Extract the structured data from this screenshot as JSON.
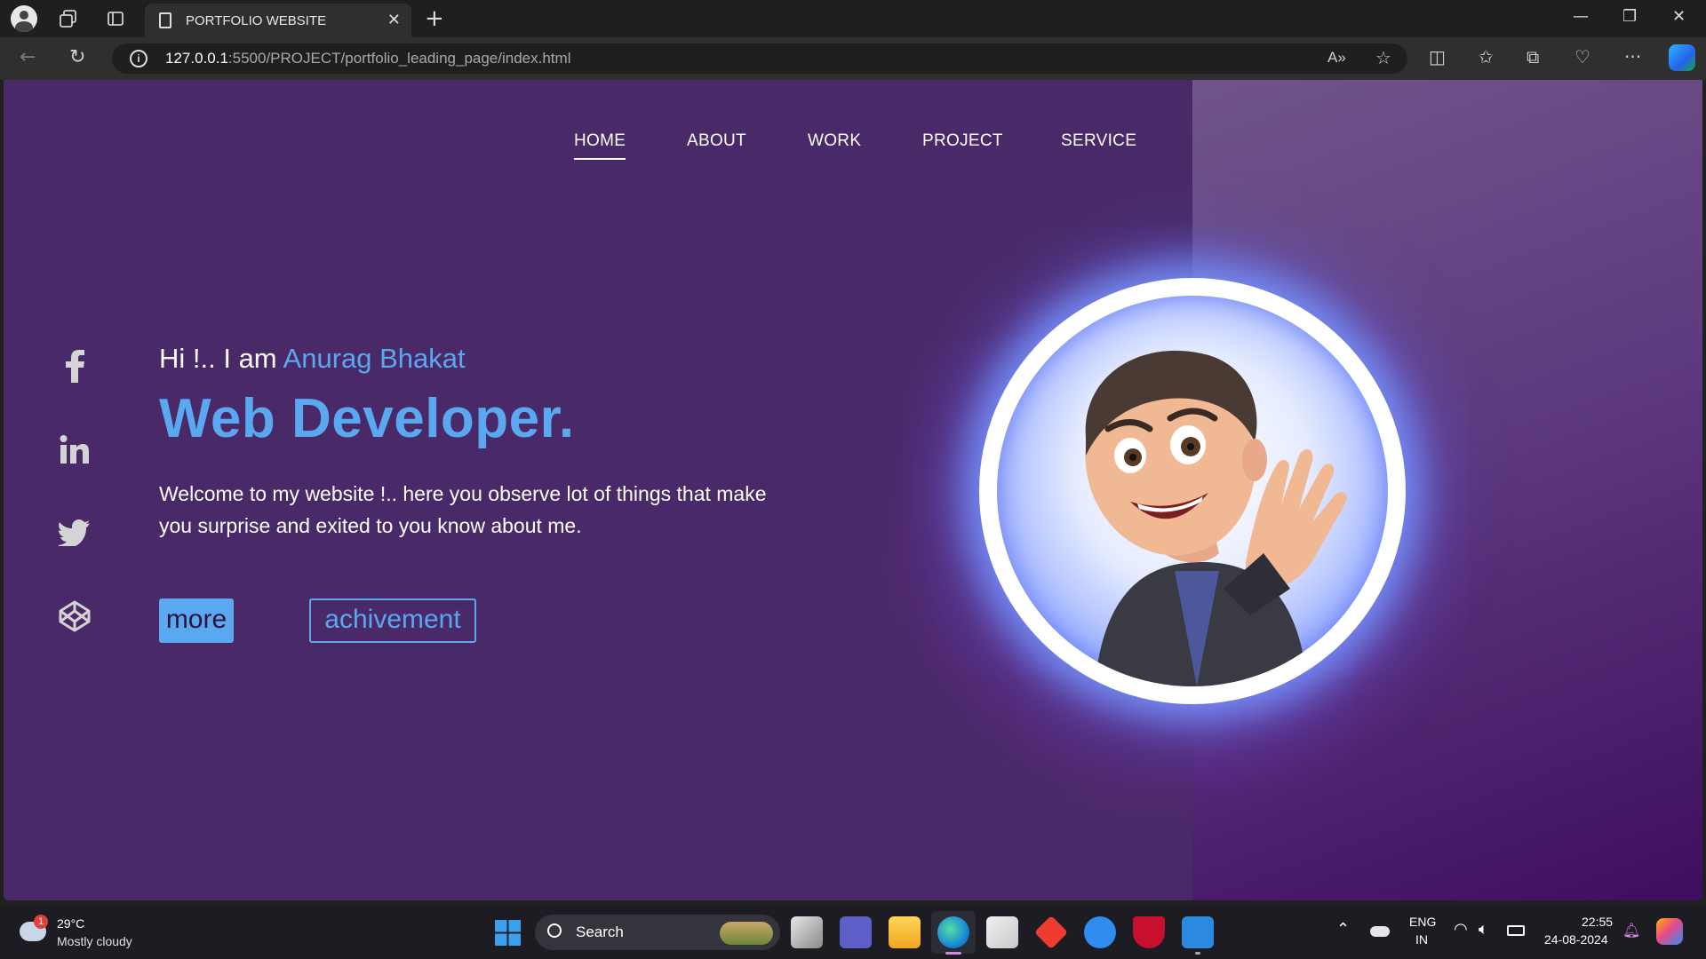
{
  "browser": {
    "tab_title": "PORTFOLIO WEBSITE",
    "url_host": "127.0.0.1",
    "url_rest": ":5500/PROJECT/portfolio_leading_page/index.html"
  },
  "nav": {
    "items": [
      "HOME",
      "ABOUT",
      "WORK",
      "PROJECT",
      "SERVICE"
    ],
    "active": "HOME"
  },
  "social": [
    "facebook-icon",
    "linkedin-icon",
    "twitter-icon",
    "codepen-icon"
  ],
  "hero": {
    "greeting": "Hi !.. I am ",
    "name": "Anurag Bhakat",
    "role": "Web Developer.",
    "description": "Welcome to my website !.. here you observe lot of things that make you surprise and exited to you know about me.",
    "primary_button": "more",
    "secondary_button": "achivement"
  },
  "taskbar": {
    "weather_badge": "1",
    "temperature": "29°C",
    "weather": "Mostly cloudy",
    "search_label": "Search",
    "lang_top": "ENG",
    "lang_bottom": "IN",
    "time": "22:55",
    "date": "24-08-2024"
  },
  "colors": {
    "page_bg": "#4a2968",
    "accent": "#59a8f0",
    "right_panel": "#71548a"
  }
}
